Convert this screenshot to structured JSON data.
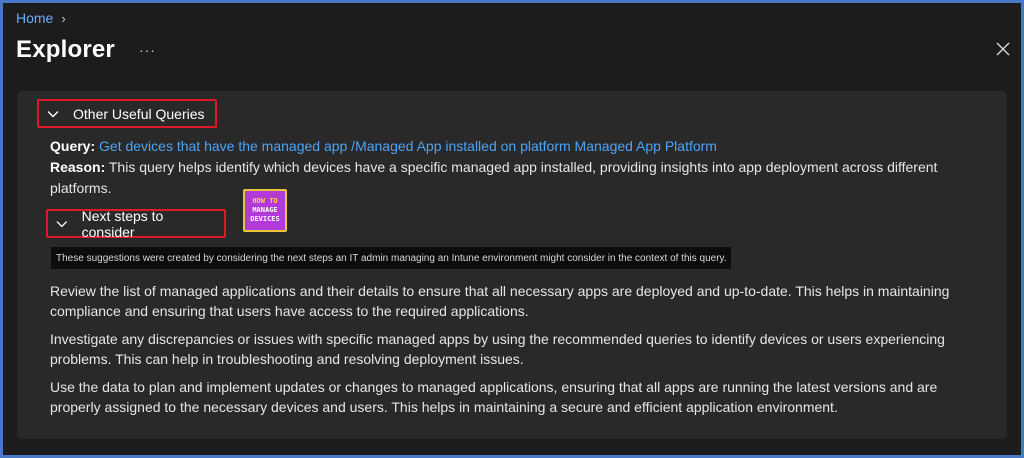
{
  "breadcrumb": {
    "home": "Home"
  },
  "header": {
    "title": "Explorer",
    "more": "···"
  },
  "sections": {
    "other_queries": {
      "label": "Other Useful Queries"
    },
    "next_steps": {
      "label": "Next steps to consider"
    }
  },
  "query": {
    "query_label": "Query:",
    "query_link": "Get devices that have the managed app /Managed App installed on platform Managed App Platform",
    "reason_label": "Reason:",
    "reason_text": "This query helps identify which devices have a specific managed app installed, providing insights into app deployment across different platforms."
  },
  "logo": {
    "line1": "HOW TO",
    "line2": "MANAGE",
    "line3": "DEVICES"
  },
  "tooltip": "These suggestions were created by considering the next steps an IT admin managing an Intune environment might consider in the context of this query.",
  "steps": [
    "Review the list of managed applications and their details to ensure that all necessary apps are deployed and up-to-date. This helps in maintaining compliance and ensuring that users have access to the required applications.",
    "Investigate any discrepancies or issues with specific managed apps by using the recommended queries to identify devices or users experiencing problems. This can help in troubleshooting and resolving deployment issues.",
    "Use the data to plan and implement updates or changes to managed applications, ensuring that all apps are running the latest versions and are properly assigned to the necessary devices and users. This helps in maintaining a secure and efficient application environment."
  ],
  "colors": {
    "accent_link": "#4ea3f5",
    "highlight_border": "#e0182a",
    "panel_bg": "#292929"
  },
  "icons": {
    "close": "close-icon",
    "chevron": "chevron-right-icon",
    "caret": "chevron-down-icon"
  }
}
